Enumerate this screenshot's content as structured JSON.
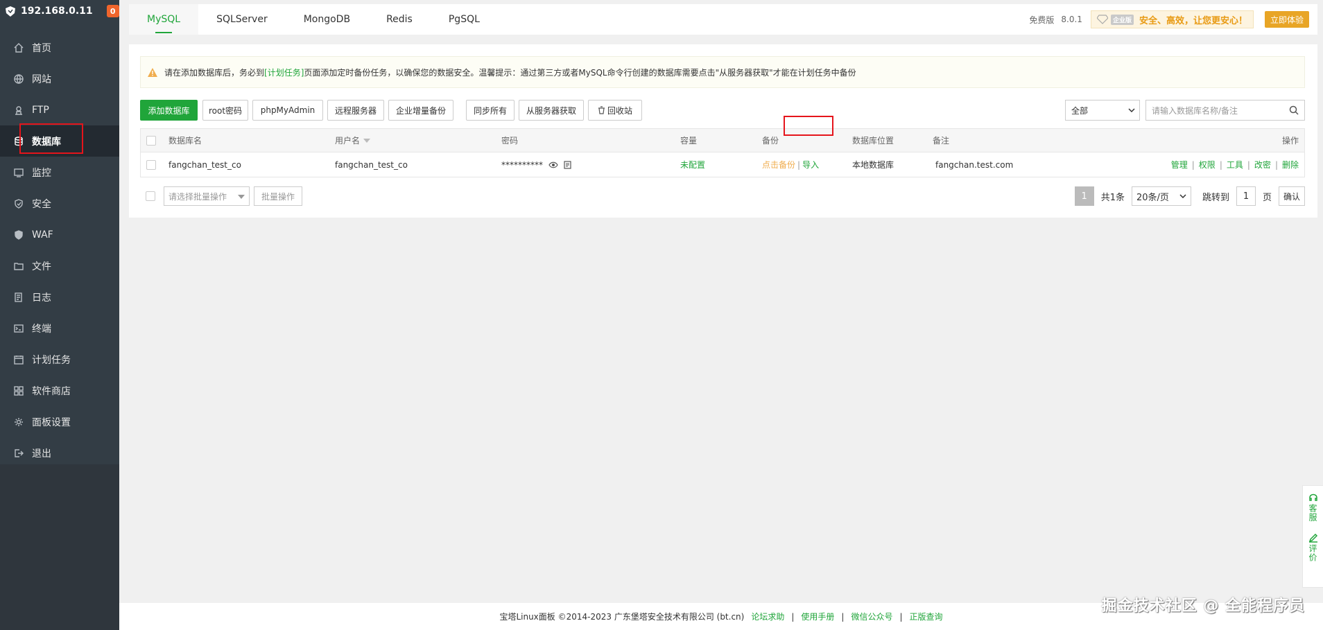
{
  "sidebar": {
    "host": "192.168.0.11",
    "badge": "0",
    "items": [
      {
        "label": "首页",
        "icon": "home-icon"
      },
      {
        "label": "网站",
        "icon": "globe-icon"
      },
      {
        "label": "FTP",
        "icon": "ftp-icon"
      },
      {
        "label": "数据库",
        "icon": "database-icon",
        "active": true
      },
      {
        "label": "监控",
        "icon": "monitor-icon"
      },
      {
        "label": "安全",
        "icon": "shield-icon"
      },
      {
        "label": "WAF",
        "icon": "waf-icon"
      },
      {
        "label": "文件",
        "icon": "folder-icon"
      },
      {
        "label": "日志",
        "icon": "log-icon"
      },
      {
        "label": "终端",
        "icon": "terminal-icon"
      },
      {
        "label": "计划任务",
        "icon": "calendar-icon"
      },
      {
        "label": "软件商店",
        "icon": "apps-icon"
      },
      {
        "label": "面板设置",
        "icon": "gear-icon"
      },
      {
        "label": "退出",
        "icon": "logout-icon"
      }
    ]
  },
  "tabs": [
    "MySQL",
    "SQLServer",
    "MongoDB",
    "Redis",
    "PgSQL"
  ],
  "top_right": {
    "edition": "免费版",
    "version": "8.0.1",
    "enterprise_tag": "企业版",
    "promo": "安全、高效，让您更安心！",
    "try_button": "立即体验"
  },
  "notice": {
    "prefix": "请在添加数据库后，务必到",
    "link": "[计划任务]",
    "suffix": "页面添加定时备份任务，以确保您的数据安全。温馨提示：通过第三方或者MySQL命令行创建的数据库需要点击\"从服务器获取\"才能在计划任务中备份"
  },
  "toolbar": {
    "add_db": "添加数据库",
    "root_pwd": "root密码",
    "phpmyadmin": "phpMyAdmin",
    "remote": "远程服务器",
    "incremental": "企业增量备份",
    "sync_all": "同步所有",
    "fetch": "从服务器获取",
    "recycle": "回收站",
    "filter": "全部",
    "search_placeholder": "请输入数据库名称/备注"
  },
  "table": {
    "headers": {
      "name": "数据库名",
      "user": "用户名",
      "password": "密码",
      "capacity": "容量",
      "backup": "备份",
      "location": "数据库位置",
      "remark": "备注",
      "ops": "操作"
    },
    "rows": [
      {
        "name": "fangchan_test_co",
        "user": "fangchan_test_co",
        "password": "**********",
        "capacity": "未配置",
        "backup_click": "点击备份",
        "backup_sep": "|",
        "import": "导入",
        "location": "本地数据库",
        "remark": "fangchan.test.com",
        "ops": [
          "管理",
          "权限",
          "工具",
          "改密",
          "删除"
        ]
      }
    ]
  },
  "batch": {
    "select_placeholder": "请选择批量操作",
    "button": "批量操作"
  },
  "pager": {
    "current": "1",
    "total": "共1条",
    "size": "20条/页",
    "goto": "跳转到",
    "goto_value": "1",
    "page_unit": "页",
    "confirm": "确认"
  },
  "float_tools": [
    "客服",
    "评价"
  ],
  "footer": {
    "copyright": "宝塔Linux面板 ©2014-2023 广东堡塔安全技术有限公司 (bt.cn)",
    "links": [
      "论坛求助",
      "使用手册",
      "微信公众号",
      "正版查询"
    ],
    "sep": "|"
  },
  "watermark": "掘金技术社区 @ 全能程序员",
  "colors": {
    "accent": "#20a53a",
    "sidebar": "#333d45",
    "warning": "#f0ad4e",
    "highlight": "#e5141b"
  }
}
